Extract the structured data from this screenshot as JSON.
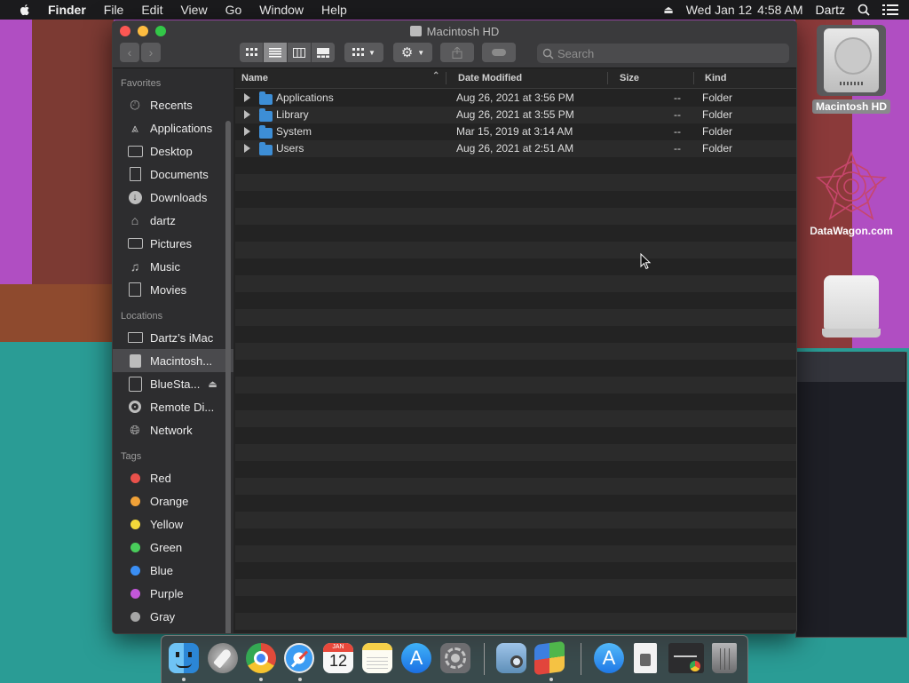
{
  "menubar": {
    "app": "Finder",
    "items": [
      "File",
      "Edit",
      "View",
      "Go",
      "Window",
      "Help"
    ],
    "date": "Wed Jan 12",
    "time": "4:58 AM",
    "user": "Dartz"
  },
  "window": {
    "title": "Macintosh HD",
    "search_placeholder": "Search"
  },
  "sidebar": {
    "favorites_header": "Favorites",
    "favorites": [
      {
        "label": "Recents",
        "icon": "clock-icon"
      },
      {
        "label": "Applications",
        "icon": "applications-icon"
      },
      {
        "label": "Desktop",
        "icon": "desktop-icon"
      },
      {
        "label": "Documents",
        "icon": "document-icon"
      },
      {
        "label": "Downloads",
        "icon": "download-icon"
      },
      {
        "label": "dartz",
        "icon": "home-icon"
      },
      {
        "label": "Pictures",
        "icon": "camera-icon"
      },
      {
        "label": "Music",
        "icon": "music-note-icon"
      },
      {
        "label": "Movies",
        "icon": "film-icon"
      }
    ],
    "locations_header": "Locations",
    "locations": [
      {
        "label": "Dartz’s iMac",
        "icon": "imac-icon"
      },
      {
        "label": "Macintosh...",
        "icon": "hard-drive-icon"
      },
      {
        "label": "BlueSta...",
        "icon": "disk-icon"
      },
      {
        "label": "Remote Di...",
        "icon": "cd-icon"
      },
      {
        "label": "Network",
        "icon": "globe-icon"
      }
    ],
    "tags_header": "Tags",
    "tags": [
      {
        "label": "Red",
        "color": "#e9514b"
      },
      {
        "label": "Orange",
        "color": "#f0a138"
      },
      {
        "label": "Yellow",
        "color": "#f3d93a"
      },
      {
        "label": "Green",
        "color": "#49cc5b"
      },
      {
        "label": "Blue",
        "color": "#3a8ef4"
      },
      {
        "label": "Purple",
        "color": "#c257d9"
      },
      {
        "label": "Gray",
        "color": "#a6a6a6"
      }
    ]
  },
  "columns": {
    "name": "Name",
    "date": "Date Modified",
    "size": "Size",
    "kind": "Kind"
  },
  "files": [
    {
      "name": "Applications",
      "date": "Aug 26, 2021 at 3:56 PM",
      "size": "--",
      "kind": "Folder"
    },
    {
      "name": "Library",
      "date": "Aug 26, 2021 at 3:55 PM",
      "size": "--",
      "kind": "Folder"
    },
    {
      "name": "System",
      "date": "Mar 15, 2019 at 3:14 AM",
      "size": "--",
      "kind": "Folder"
    },
    {
      "name": "Users",
      "date": "Aug 26, 2021 at 2:51 AM",
      "size": "--",
      "kind": "Folder"
    }
  ],
  "desktop": {
    "hd_label": "Macintosh HD",
    "datawagon_label": "DataWagon.com"
  },
  "dock": {
    "calendar_month": "JAN",
    "calendar_day": "12"
  }
}
